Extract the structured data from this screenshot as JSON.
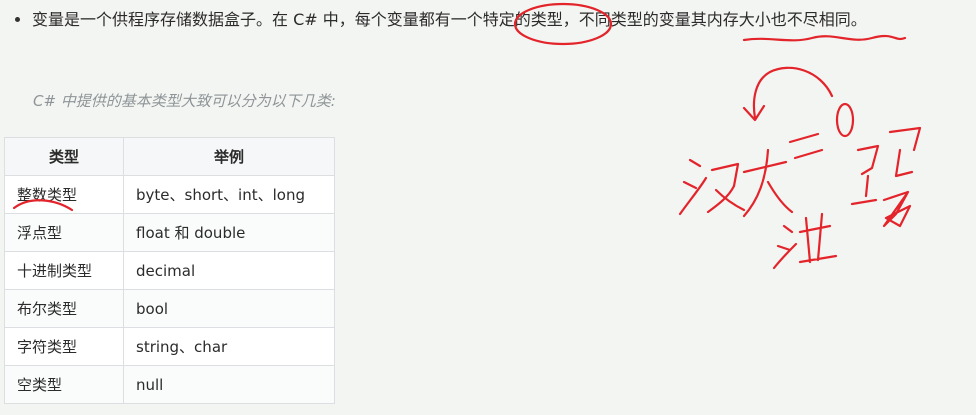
{
  "paragraph": {
    "text": "变量是一个供程序存储数据盒子。在 C# 中，每个变量都有一个特定的类型，不同类型的变量其内存大小也不尽相同。"
  },
  "note": {
    "text": "C# 中提供的基本类型大致可以分为以下几类:"
  },
  "table": {
    "headers": [
      "类型",
      "举例"
    ],
    "rows": [
      [
        "整数类型",
        "byte、short、int、long"
      ],
      [
        "浮点型",
        "float 和 double"
      ],
      [
        "十进制类型",
        "decimal"
      ],
      [
        "布尔类型",
        "bool"
      ],
      [
        "字符类型",
        "string、char"
      ],
      [
        "空类型",
        "null"
      ]
    ]
  },
  "annotations": {
    "color": "#e3242b",
    "description_none": true
  }
}
